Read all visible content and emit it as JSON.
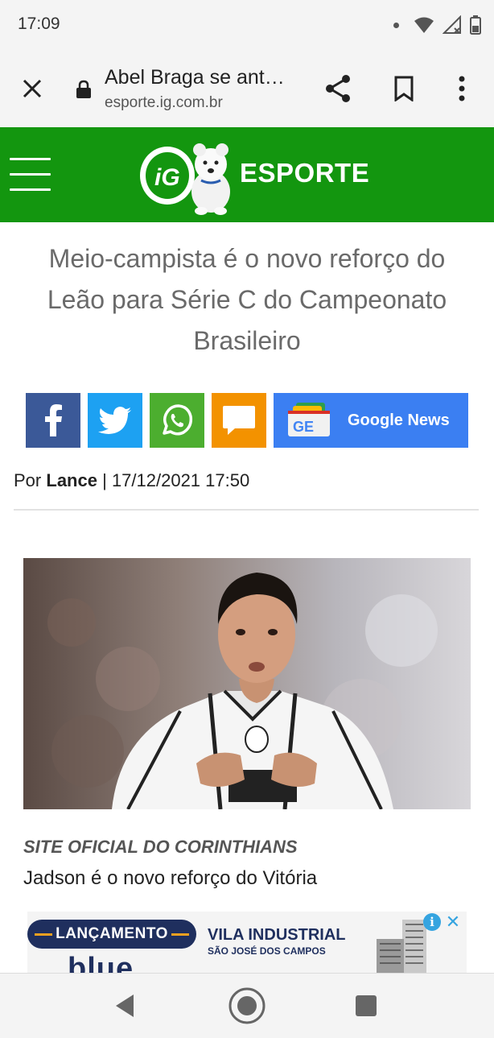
{
  "status_bar": {
    "time": "17:09"
  },
  "browser": {
    "page_title": "Abel Braga se ant…",
    "domain": "esporte.ig.com.br"
  },
  "site_header": {
    "logo_text": "iG",
    "section": "ESPORTE",
    "brand_color": "#13960f"
  },
  "article": {
    "headline": "Meio-campista é o novo reforço do Leão para Série C do Campeonato Brasileiro",
    "byline_prefix": "Por",
    "author": "Lance",
    "separator": "|",
    "datetime": "17/12/2021 17:50",
    "photo_credit": "SITE OFICIAL DO CORINTHIANS",
    "photo_caption": "Jadson é o novo reforço do Vitória"
  },
  "share": {
    "facebook_icon": "facebook-icon",
    "twitter_icon": "twitter-icon",
    "whatsapp_icon": "whatsapp-icon",
    "comment_icon": "comment-icon",
    "google_news_label": "Google News",
    "google_news_icon_text": "GE"
  },
  "ad": {
    "tag": "LANÇAMENTO",
    "title": "VILA INDUSTRIAL",
    "subtitle": "SÃO JOSÉ DOS CAMPOS",
    "brand": "blue"
  }
}
